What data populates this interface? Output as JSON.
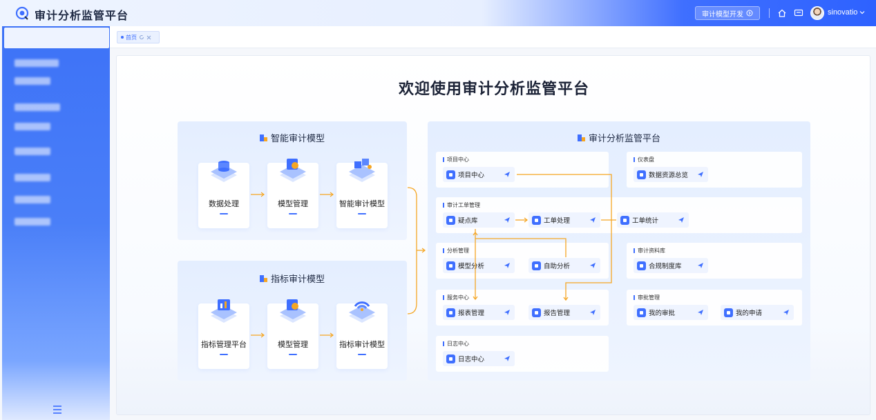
{
  "header": {
    "title": "审计分析监管平台",
    "dev_button": "审计模型开发",
    "username": "sinovatio"
  },
  "tabs": [
    {
      "label": "首页"
    }
  ],
  "main": {
    "page_title": "欢迎使用审计分析监管平台",
    "smart_panel": {
      "title": "智能审计模型",
      "cards": [
        {
          "label": "数据处理"
        },
        {
          "label": "模型管理"
        },
        {
          "label": "智能审计模型"
        }
      ]
    },
    "indicator_panel": {
      "title": "指标审计模型",
      "cards": [
        {
          "label": "指标管理平台"
        },
        {
          "label": "模型管理"
        },
        {
          "label": "指标审计模型"
        }
      ]
    },
    "platform_panel": {
      "title": "审计分析监管平台",
      "sections": [
        {
          "title": "项目中心",
          "items": [
            "项目中心"
          ]
        },
        {
          "title": "仪表盘",
          "items": [
            "数据资源总览"
          ]
        },
        {
          "title": "审计工单管理",
          "items": [
            "疑点库",
            "工单处理",
            "工单统计"
          ]
        },
        {
          "title": "分析管理",
          "items": [
            "模型分析",
            "自助分析"
          ]
        },
        {
          "title": "审计资料库",
          "items": [
            "合规制度库"
          ]
        },
        {
          "title": "服务中心",
          "items": [
            "报表管理",
            "报告管理"
          ]
        },
        {
          "title": "审批管理",
          "items": [
            "我的审批",
            "我的申请"
          ]
        },
        {
          "title": "日志中心",
          "items": [
            "日志中心"
          ]
        }
      ]
    }
  },
  "colors": {
    "accent": "#3f6fff",
    "flow": "#f5a623",
    "sidebar": "#4a7ff8"
  }
}
